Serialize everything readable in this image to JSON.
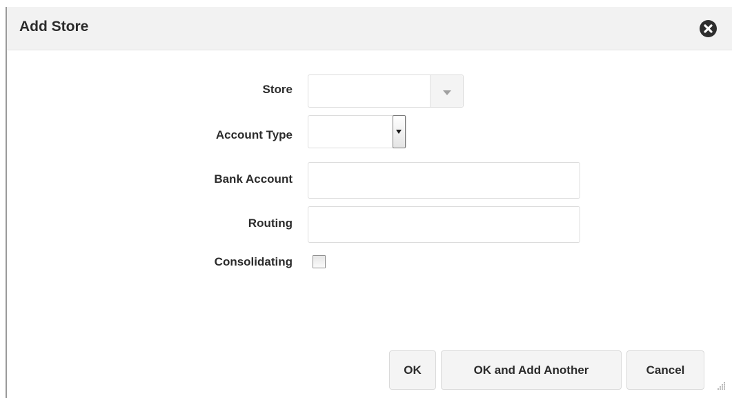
{
  "dialog": {
    "title": "Add Store",
    "close_icon": "close-icon"
  },
  "form": {
    "store": {
      "label": "Store",
      "value": ""
    },
    "account_type": {
      "label": "Account Type",
      "value": ""
    },
    "bank_account": {
      "label": "Bank Account",
      "value": ""
    },
    "routing": {
      "label": "Routing",
      "value": ""
    },
    "consolidating": {
      "label": "Consolidating",
      "checked": false
    }
  },
  "buttons": {
    "ok": "OK",
    "ok_and_add_another": "OK and Add Another",
    "cancel": "Cancel"
  },
  "colors": {
    "title_bar": "#f2f2f2",
    "text": "#2b2b2b",
    "button_bg": "#f4f4f4"
  }
}
